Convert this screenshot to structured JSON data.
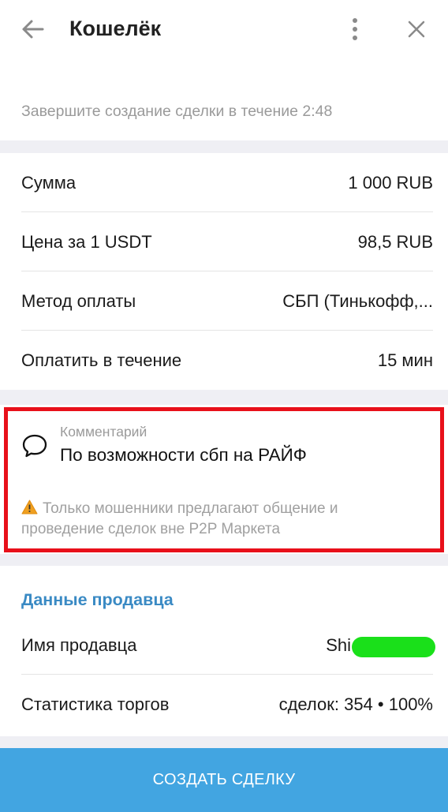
{
  "header": {
    "title": "Кошелёк",
    "timer_text": "Завершите создание сделки в течение 2:48"
  },
  "details": [
    {
      "label": "Сумма",
      "value": "1 000 RUB"
    },
    {
      "label": "Цена за 1 USDT",
      "value": "98,5 RUB"
    },
    {
      "label": "Метод оплаты",
      "value": "СБП (Тинькофф,..."
    },
    {
      "label": "Оплатить в течение",
      "value": "15 мин"
    }
  ],
  "comment": {
    "label": "Комментарий",
    "text": "По возможности сбп на РАЙФ",
    "warning": "Только мошенники предлагают общение и проведение сделок вне P2P Маркета"
  },
  "seller": {
    "title": "Данные продавца",
    "name_label": "Имя продавца",
    "name_value": "Shi",
    "stats_label": "Статистика торгов",
    "stats_value": "сделок: 354 • 100%"
  },
  "cta": {
    "label": "СОЗДАТЬ СДЕЛКУ"
  },
  "colors": {
    "accent": "#42a5e1",
    "link": "#3a8ac4",
    "highlight_border": "#e8101a",
    "redaction": "#1ae01a"
  },
  "icons": [
    "arrow-left-icon",
    "more-vertical-icon",
    "close-icon",
    "chat-bubble-icon",
    "warning-icon"
  ]
}
